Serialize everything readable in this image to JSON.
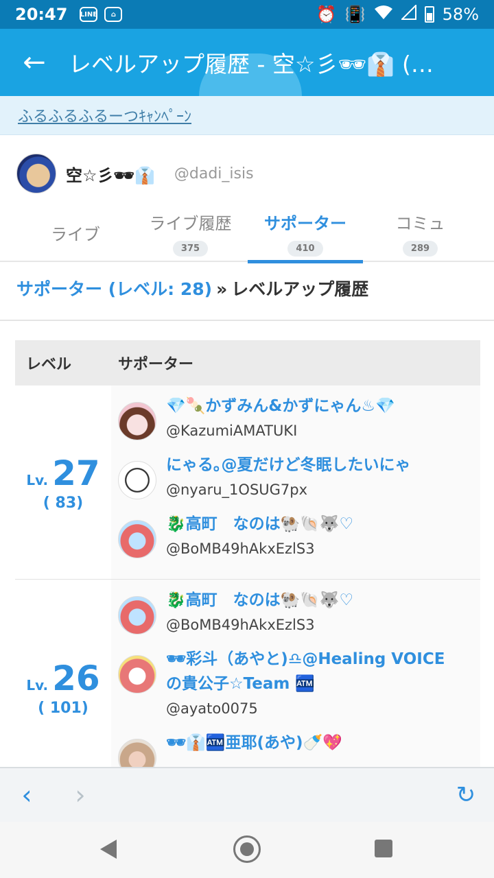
{
  "status_bar": {
    "time": "20:47",
    "battery": "58%",
    "left_icons": [
      "LINE",
      "⌂"
    ]
  },
  "app_bar": {
    "back_glyph": "←",
    "title": "レベルアップ履歴 - 空☆彡🕶👔 (…"
  },
  "campaign": {
    "label": "ふるふるふるーつｷｬﾝﾍﾟｰﾝ"
  },
  "profile": {
    "name": "空☆彡🕶👔",
    "handle": "@dadi_isis"
  },
  "tabs": [
    {
      "label": "ライブ",
      "count": ""
    },
    {
      "label": "ライブ履歴",
      "count": "375"
    },
    {
      "label": "サポーター",
      "count": "410"
    },
    {
      "label": "コミュ",
      "count": "289"
    }
  ],
  "breadcrumb": {
    "link": "サポーター (レベル: 28)",
    "separator": "»",
    "current": "レベルアップ履歴"
  },
  "table": {
    "headers": [
      "レベル",
      "サポーター"
    ],
    "rows": [
      {
        "lv_prefix": "Lv.",
        "level": "27",
        "count": "( 83)",
        "supporters": [
          {
            "name": "💎🍡かずみん&かずにゃん♨💎",
            "handle": "@KazumiAMATUKI"
          },
          {
            "name": "にゃる｡@夏だけど冬眠したいにゃ",
            "handle": "@nyaru_1OSUG7px"
          },
          {
            "name": "🐉高町　なのは🐏🐚🐺♡",
            "handle": "@BoMB49hAkxEzlS3"
          }
        ]
      },
      {
        "lv_prefix": "Lv.",
        "level": "26",
        "count": "( 101)",
        "supporters": [
          {
            "name": "🐉高町　なのは🐏🐚🐺♡",
            "handle": "@BoMB49hAkxEzlS3"
          },
          {
            "name": "🕶彩斗（あやと)♎@Healing VOICEの貴公子☆Team 🏧",
            "handle": "@ayato0075"
          },
          {
            "name": "🕶👔🏧亜耶(あや)🍼💖",
            "handle": ""
          }
        ]
      }
    ]
  },
  "browser_bar": {
    "back": "‹",
    "forward": "›",
    "reload": "↻"
  },
  "colors": {
    "status_bar": "#0b7bb5",
    "app_bar": "#1aa3e2",
    "accent": "#2f8fde"
  }
}
